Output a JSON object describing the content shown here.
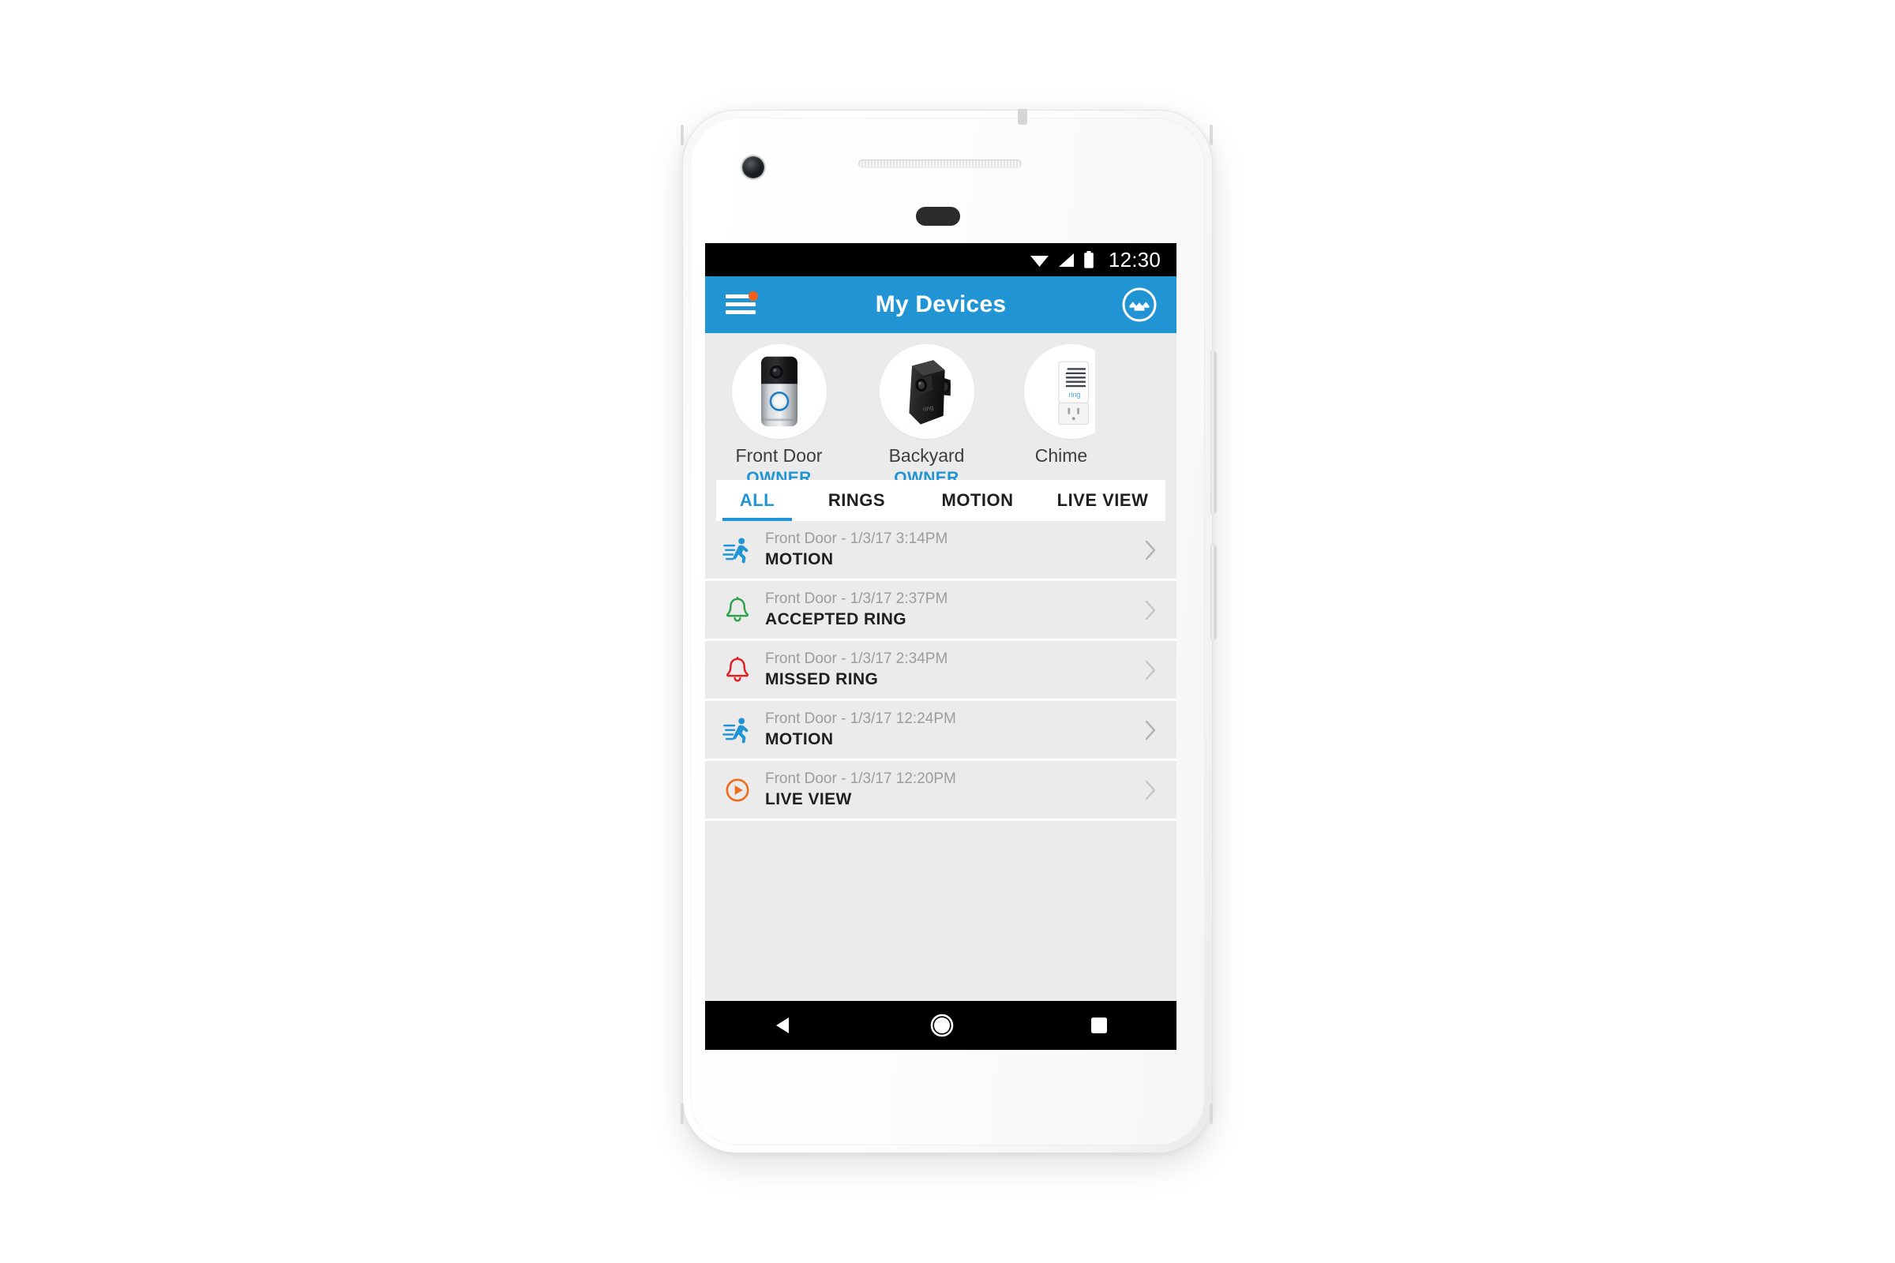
{
  "app": {
    "name": "Ring",
    "header": {
      "title": "My Devices",
      "menu_icon": "hamburger-menu-icon",
      "menu_badge": "notification-badge",
      "logo_icon": "ring-logo-icon",
      "background_color": "#2195D3"
    }
  },
  "status_bar": {
    "time": "12:30",
    "wifi_icon": "wifi-icon",
    "signal_icon": "cellular-signal-icon",
    "battery_icon": "battery-full-icon",
    "background_color": "#000000"
  },
  "carousel": {
    "devices": [
      {
        "name": "Front Door",
        "role": "OWNER",
        "product": "video-doorbell"
      },
      {
        "name": "Backyard",
        "role": "OWNER",
        "product": "stick-up-cam"
      },
      {
        "name": "Chime",
        "role": "",
        "product": "chime"
      }
    ]
  },
  "tabs": {
    "items": [
      {
        "label": "ALL",
        "active": true
      },
      {
        "label": "RINGS",
        "active": false
      },
      {
        "label": "MOTION",
        "active": false
      },
      {
        "label": "LIVE VIEW",
        "active": false
      }
    ],
    "active_color": "#2195D3"
  },
  "events": {
    "chevron_icon": "chevron-right-icon",
    "rows": [
      {
        "meta": "Front Door - 1/3/17 3:14PM",
        "type": "MOTION",
        "icon": "motion-running-icon",
        "color": "#2195D3"
      },
      {
        "meta": "Front Door - 1/3/17 2:37PM",
        "type": "ACCEPTED RING",
        "icon": "bell-accepted-icon",
        "color": "#2FA14C"
      },
      {
        "meta": "Front Door - 1/3/17 2:34PM",
        "type": "MISSED RING",
        "icon": "bell-missed-icon",
        "color": "#E01F26"
      },
      {
        "meta": "Front Door - 1/3/17 12:24PM",
        "type": "MOTION",
        "icon": "motion-running-icon",
        "color": "#2195D3"
      },
      {
        "meta": "Front Door - 1/3/17 12:20PM",
        "type": "LIVE VIEW",
        "icon": "live-view-play-icon",
        "color": "#EE6C1E"
      }
    ]
  },
  "nav_bar": {
    "back": "back-triangle-icon",
    "home": "home-circle-icon",
    "recents": "recents-square-icon"
  }
}
